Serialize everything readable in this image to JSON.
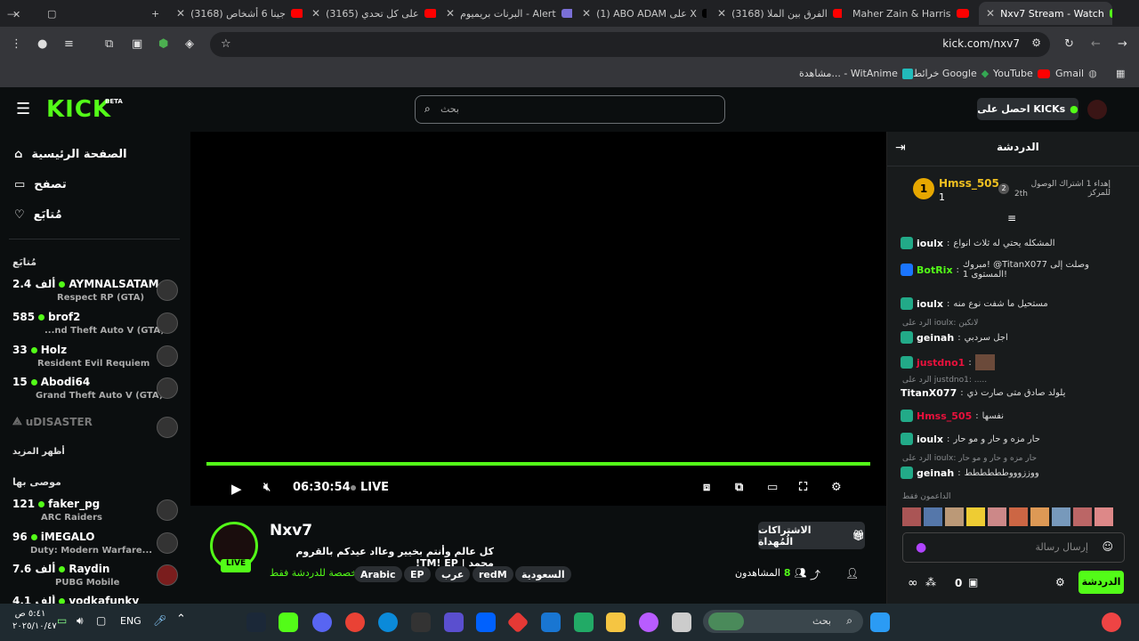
{
  "browser": {
    "tabs": [
      {
        "label": "Nxv7 Stream - Watch",
        "color": "#53fc18",
        "active": true
      },
      {
        "label": "Maher Zain & Harris",
        "color": "#ff0000"
      },
      {
        "label": "(3168) الفرق بين الملا",
        "color": "#ff0000"
      },
      {
        "label": "(1) ABO ADAM على X",
        "color": "#ffffff"
      },
      {
        "label": "البرنات بريميوم - Alert",
        "color": "#7a6fd6"
      },
      {
        "label": "(3165) على كل تحدي",
        "color": "#ff0000"
      },
      {
        "label": "(3168) جينا 6 أشخاص",
        "color": "#ff0000"
      }
    ],
    "new_tab_icon": "plus-icon",
    "address": "kick.com/nxv7",
    "bookmarks": [
      "Gmail",
      "YouTube",
      "خرائط Google",
      "مشاهدة... - WitAnime"
    ]
  },
  "kick": {
    "logo": "KICK",
    "logo_beta": "BETA",
    "search_placeholder": "بحث",
    "get_kicks": "احصل على KICKs",
    "nav": {
      "home": "الصفحة الرئيسية",
      "browse": "تصفح",
      "following": "مُتابَع"
    },
    "following_title": "مُتابَع",
    "following": [
      {
        "name": "AYMNALSATAM",
        "viewers": "2.4 ألف",
        "game": "Respect RP (GTA)"
      },
      {
        "name": "brof2",
        "viewers": "585",
        "game": "...nd Theft Auto V (GTA)"
      },
      {
        "name": "Holz",
        "viewers": "33",
        "game": "Resident Evil Requiem"
      },
      {
        "name": "Abodi64",
        "viewers": "15",
        "game": "Grand Theft Auto V (GTA)"
      }
    ],
    "offline_channel": "uDISASTER",
    "show_more": "أظهر المزيد",
    "recommended_title": "موصى بها",
    "recommended": [
      {
        "name": "faker_pg",
        "viewers": "121",
        "game": "ARC Raiders"
      },
      {
        "name": "iMEGALO",
        "viewers": "96",
        "game": "Duty: Modern Warfare..."
      },
      {
        "name": "Raydin",
        "viewers": "7.6 ألف",
        "game": "PUBG Mobile"
      },
      {
        "name": "vodkafunky",
        "viewers": "4.1 ألف",
        "game": ""
      }
    ],
    "player": {
      "time": "06:30:54",
      "live": "LIVE",
      "progress": 1.0
    },
    "stream": {
      "channel": "Nxv7",
      "title": "كل عالم وأنتم بخيير وعااد عيدكم بالقروم محمد | TM! EP!",
      "chat_only": "مخصصة للدردشة فقط",
      "tags": [
        "السعودية",
        "redM",
        "عرب",
        "EP",
        "Arabic"
      ],
      "viewers_label": "المشاهدون",
      "viewers": "8",
      "gift_button": "الاشتراكات الُمُهداة",
      "live_badge": "LIVE"
    },
    "chat": {
      "title": "الدردشة",
      "leader": {
        "name": "Hmss_505",
        "count": "1",
        "rank_text": "إهداء 1 اشتراك الوصول للمركز",
        "rank": "2th"
      },
      "messages": [
        {
          "user": "ioulx",
          "text": "المشكله يحتي له ثلاث انواع",
          "color": "#ffffff"
        },
        {
          "user": "BotRix",
          "text": "مبروك! @TitanX077 وصلت إلى المستوى 1!",
          "color": "#53fc18"
        },
        {
          "user": "ioulx",
          "text": "مستحيل ما شفت نوع منه",
          "color": "#ffffff"
        },
        {
          "user": "geinah",
          "text": "اجل سردبي",
          "color": "#ffffff",
          "reply": "الرد على ioulx: لانكين"
        },
        {
          "user": "justdno1",
          "text": "",
          "color": "#e9113c"
        },
        {
          "user": "TitanX077",
          "text": "يلولد صادق متى صارت ذي",
          "color": "#ffffff",
          "reply": "الرد على justdno1: ....."
        },
        {
          "user": "Hmss_505",
          "text": "نفسها",
          "color": "#e9113c"
        },
        {
          "user": "ioulx",
          "text": "حار مزه و حار و مو حار",
          "color": "#ffffff"
        },
        {
          "user": "geinah",
          "text": "ووززوووطططططط",
          "color": "#ffffff",
          "reply": "الرد على ioulx: حار مزه و حار و مو حار"
        }
      ],
      "supporters_label": "الداعمون فقط",
      "input_placeholder": "إرسال رسالة",
      "send_button": "الدردشة",
      "points": "0"
    }
  },
  "taskbar": {
    "search_placeholder": "بحث",
    "lang": "ENG",
    "time": "٥:٤١ ص",
    "date": "٢٠٢٥/١٠/٤٧"
  }
}
